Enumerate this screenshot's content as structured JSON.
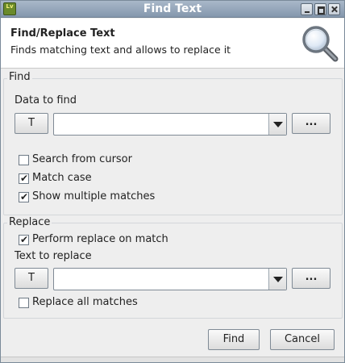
{
  "window": {
    "title": "Find Text",
    "app_icon_text": "Lv",
    "controls": [
      "minimize-icon",
      "maximize-icon",
      "close-icon"
    ]
  },
  "header": {
    "title": "Find/Replace Text",
    "description": "Finds matching text and allows to replace it",
    "icon": "magnifier-icon"
  },
  "find": {
    "legend": "Find",
    "data_label": "Data to find",
    "type_button": "T",
    "value": "",
    "more_button": "...",
    "options": {
      "search_from_cursor": {
        "label": "Search from cursor",
        "checked": false
      },
      "match_case": {
        "label": "Match case",
        "checked": true
      },
      "show_multiple_matches": {
        "label": "Show multiple matches",
        "checked": true
      }
    }
  },
  "replace": {
    "legend": "Replace",
    "perform_replace": {
      "label": "Perform replace on match",
      "checked": true
    },
    "text_label": "Text to replace",
    "type_button": "T",
    "value": "",
    "more_button": "...",
    "replace_all": {
      "label": "Replace all matches",
      "checked": false
    }
  },
  "buttons": {
    "find": "Find",
    "cancel": "Cancel"
  },
  "check_glyph": "✔"
}
